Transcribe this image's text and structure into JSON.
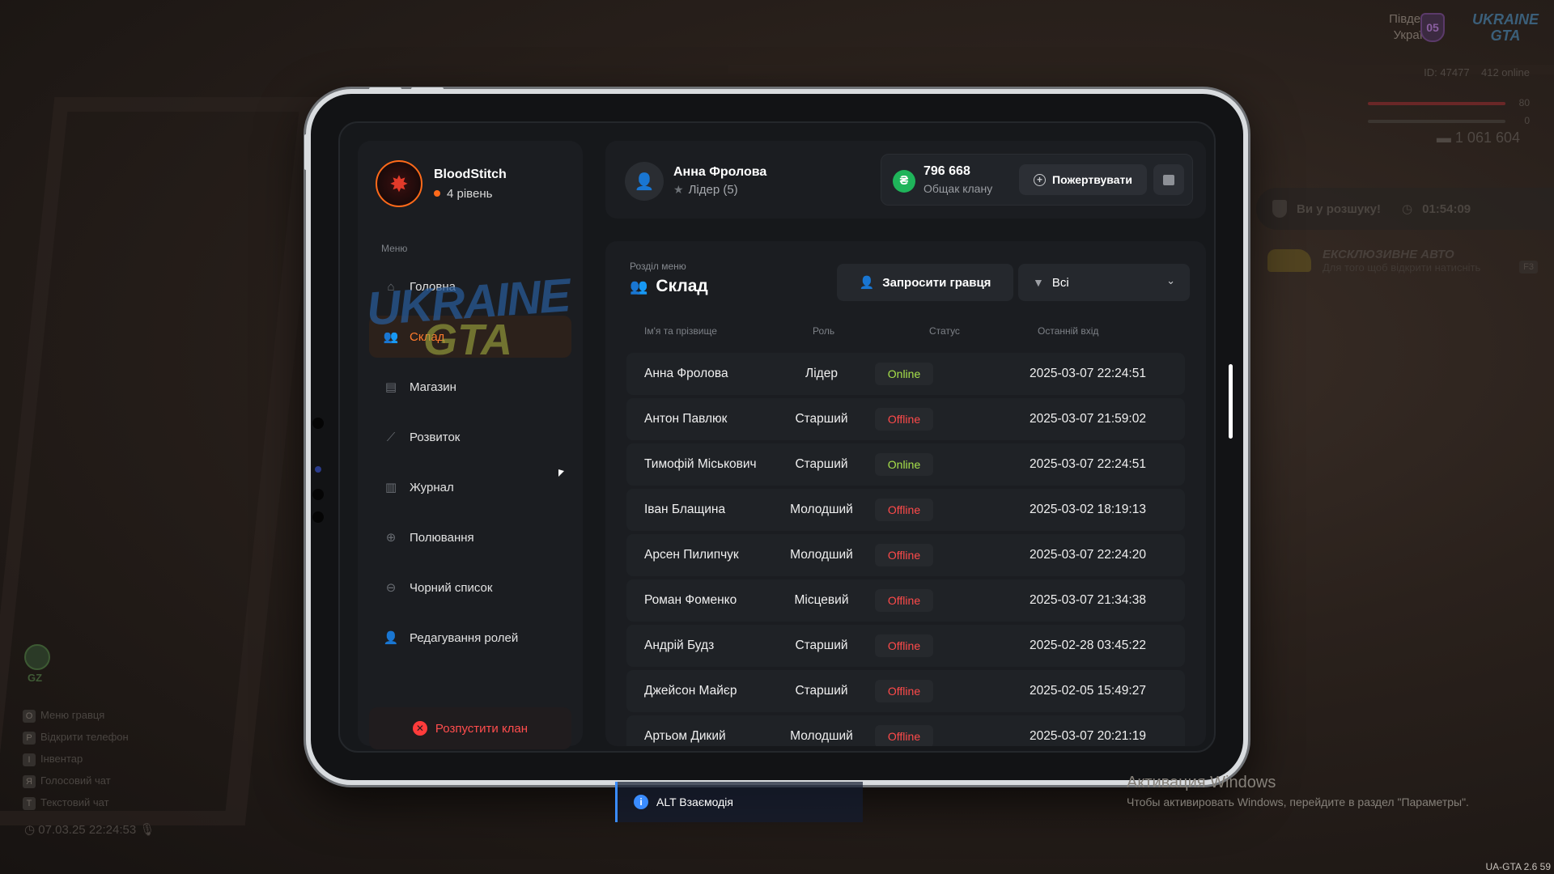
{
  "hud": {
    "region_line1": "Південна",
    "region_line2": "Україна",
    "region_badge": "05",
    "server_logo": "UKRAINE GTA",
    "player_id": "ID: 47477",
    "online": "412 online",
    "health": "80",
    "armor": "0",
    "money": "1 061 604",
    "wanted_text": "Ви у розшуку!",
    "wanted_timer": "01:54:09",
    "exclusive_title": "ЕКСКЛЮЗИВНЕ АВТО",
    "exclusive_sub": "Для того щоб відкрити натисніть",
    "exclusive_key": "F3",
    "zone": "GZ",
    "hints": [
      {
        "key": "O",
        "label": "Меню гравця"
      },
      {
        "key": "P",
        "label": "Відкрити телефон"
      },
      {
        "key": "I",
        "label": "Інвентар"
      },
      {
        "key": "Я",
        "label": "Голосовий чат"
      },
      {
        "key": "T",
        "label": "Текстовий чат"
      }
    ],
    "datetime": "07.03.25 22:24:53",
    "alt_interact": "ALT Взаємодія",
    "win_activation_title": "Активация Windows",
    "win_activation_sub": "Чтобы активировать Windows, перейдите в раздел \"Параметры\".",
    "version": "UA-GTA 2.6   59"
  },
  "sidebar": {
    "clan_name": "BloodStitch",
    "clan_level": "4 рівень",
    "menu_label": "Меню",
    "items": [
      {
        "label": "Головна",
        "icon": "home-icon"
      },
      {
        "label": "Склад",
        "icon": "people-icon"
      },
      {
        "label": "Магазин",
        "icon": "basket-icon"
      },
      {
        "label": "Розвиток",
        "icon": "chart-icon"
      },
      {
        "label": "Журнал",
        "icon": "book-icon"
      },
      {
        "label": "Полювання",
        "icon": "crosshair-icon"
      },
      {
        "label": "Чорний список",
        "icon": "block-icon"
      },
      {
        "label": "Редагування ролей",
        "icon": "user-edit-icon"
      }
    ],
    "active_item": "Склад",
    "disband_label": "Розпустити клан"
  },
  "header": {
    "user_name": "Анна Фролова",
    "user_role": "Лідер (5)",
    "fund_value": "796 668",
    "fund_label": "Общак клану",
    "donate_label": "Пожертвувати"
  },
  "panel": {
    "section_label": "Розділ меню",
    "section_title": "Склад",
    "invite_label": "Запросити гравця",
    "filter_value": "Всі",
    "columns": [
      "Ім'я та прізвище",
      "Роль",
      "Статус",
      "Останній вхід"
    ],
    "rows": [
      {
        "name": "Анна Фролова",
        "role": "Лідер",
        "status": "Online",
        "last": "2025-03-07 22:24:51"
      },
      {
        "name": "Антон Павлюк",
        "role": "Старший",
        "status": "Offline",
        "last": "2025-03-07 21:59:02"
      },
      {
        "name": "Тимофій Міськович",
        "role": "Старший",
        "status": "Online",
        "last": "2025-03-07 22:24:51"
      },
      {
        "name": "Іван Блащина",
        "role": "Молодший",
        "status": "Offline",
        "last": "2025-03-02 18:19:13"
      },
      {
        "name": "Арсен Пилипчук",
        "role": "Молодший",
        "status": "Offline",
        "last": "2025-03-07 22:24:20"
      },
      {
        "name": "Роман Фоменко",
        "role": "Місцевий",
        "status": "Offline",
        "last": "2025-03-07 21:34:38"
      },
      {
        "name": "Андрій Будз",
        "role": "Старший",
        "status": "Offline",
        "last": "2025-02-28 03:45:22"
      },
      {
        "name": "Джейсон Майєр",
        "role": "Старший",
        "status": "Offline",
        "last": "2025-02-05 15:49:27"
      },
      {
        "name": "Артьом Дикий",
        "role": "Молодший",
        "status": "Offline",
        "last": "2025-03-07 20:21:19"
      }
    ]
  },
  "colors": {
    "accent": "#ff7a2c",
    "online": "#a7e04a",
    "offline": "#ff4a4a",
    "fund": "#1fb45a"
  }
}
